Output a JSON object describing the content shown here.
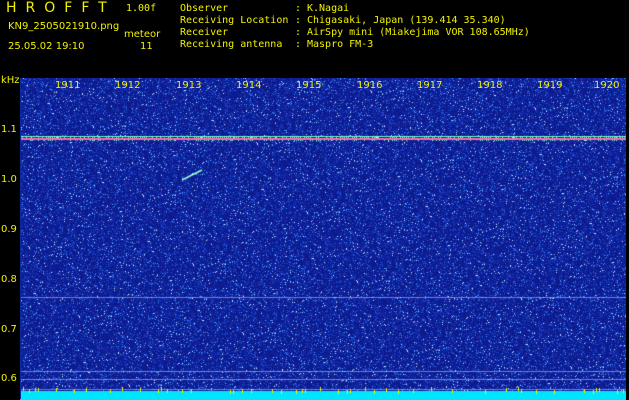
{
  "header": {
    "app_title": "HROFFT",
    "version": "1.00f",
    "filename": "KN9_2505021910.png",
    "datetime": "25.05.02 19:10",
    "meteor_label": "meteor",
    "meteor_count": "11",
    "info": [
      {
        "key": "Observer",
        "value": "K.Nagai"
      },
      {
        "key": "Receiving Location",
        "value": "Chigasaki, Japan (139.414 35.340)"
      },
      {
        "key": "Receiver",
        "value": "AirSpy mini (Miakejima VOR 108.65MHz)"
      },
      {
        "key": "Receiving antenna",
        "value": "Maspro FM-3"
      }
    ]
  },
  "spectrogram": {
    "y_unit": "kHz",
    "y_ticks": [
      "1.1",
      "1.0",
      "0.9",
      "0.8",
      "0.7",
      "0.6"
    ],
    "x_ticks": [
      "1911",
      "1912",
      "1913",
      "1914",
      "1915",
      "1916",
      "1917",
      "1918",
      "1919",
      "1920"
    ],
    "colors": {
      "background": "#0d1a8c",
      "noise_hi": "#3a8cff",
      "carrier": "#ff66aa",
      "carrier_side": "#66ffcc",
      "bottom_band": "#00e5ff",
      "label": "#f2f200"
    }
  }
}
